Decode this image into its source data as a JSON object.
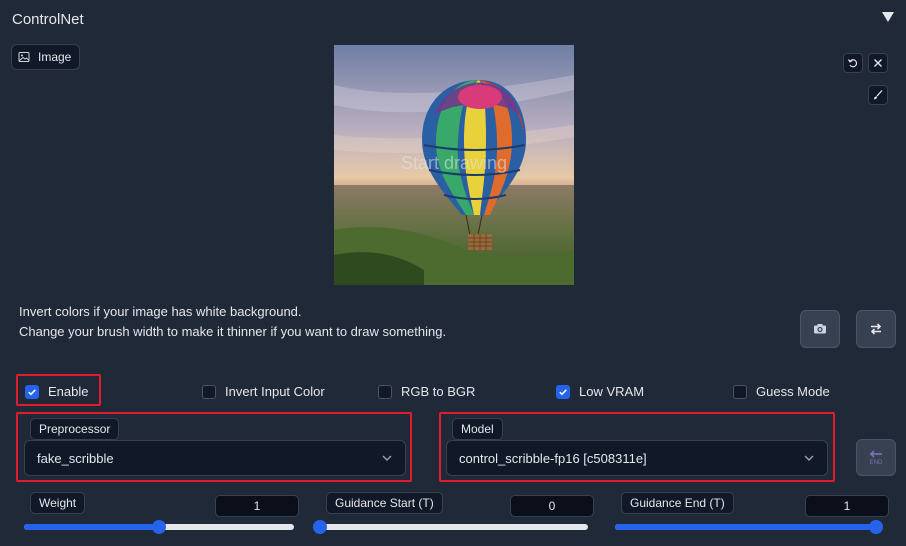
{
  "panel": {
    "title": "ControlNet"
  },
  "image_tab": {
    "label": "Image"
  },
  "canvas": {
    "overlay_text": "Start drawing"
  },
  "hints": [
    "Invert colors if your image has white background.",
    "Change your brush width to make it thinner if you want to draw something."
  ],
  "options": [
    {
      "label": "Enable",
      "checked": true
    },
    {
      "label": "Invert Input Color",
      "checked": false
    },
    {
      "label": "RGB to BGR",
      "checked": false
    },
    {
      "label": "Low VRAM",
      "checked": true
    },
    {
      "label": "Guess Mode",
      "checked": false
    }
  ],
  "preprocessor": {
    "label": "Preprocessor",
    "value": "fake_scribble"
  },
  "model": {
    "label": "Model",
    "value": "control_scribble-fp16 [c508311e]"
  },
  "sliders": {
    "weight": {
      "label": "Weight",
      "value": "1",
      "fraction": 0.5
    },
    "guidance_start": {
      "label": "Guidance Start (T)",
      "value": "0",
      "fraction": 0.0
    },
    "guidance_end": {
      "label": "Guidance End (T)",
      "value": "1",
      "fraction": 1.0
    }
  },
  "send_button": {
    "label": "END"
  },
  "colors": {
    "accent": "#2563eb",
    "highlight_box": "#e11d2b",
    "panel_bg": "#1f2937"
  }
}
